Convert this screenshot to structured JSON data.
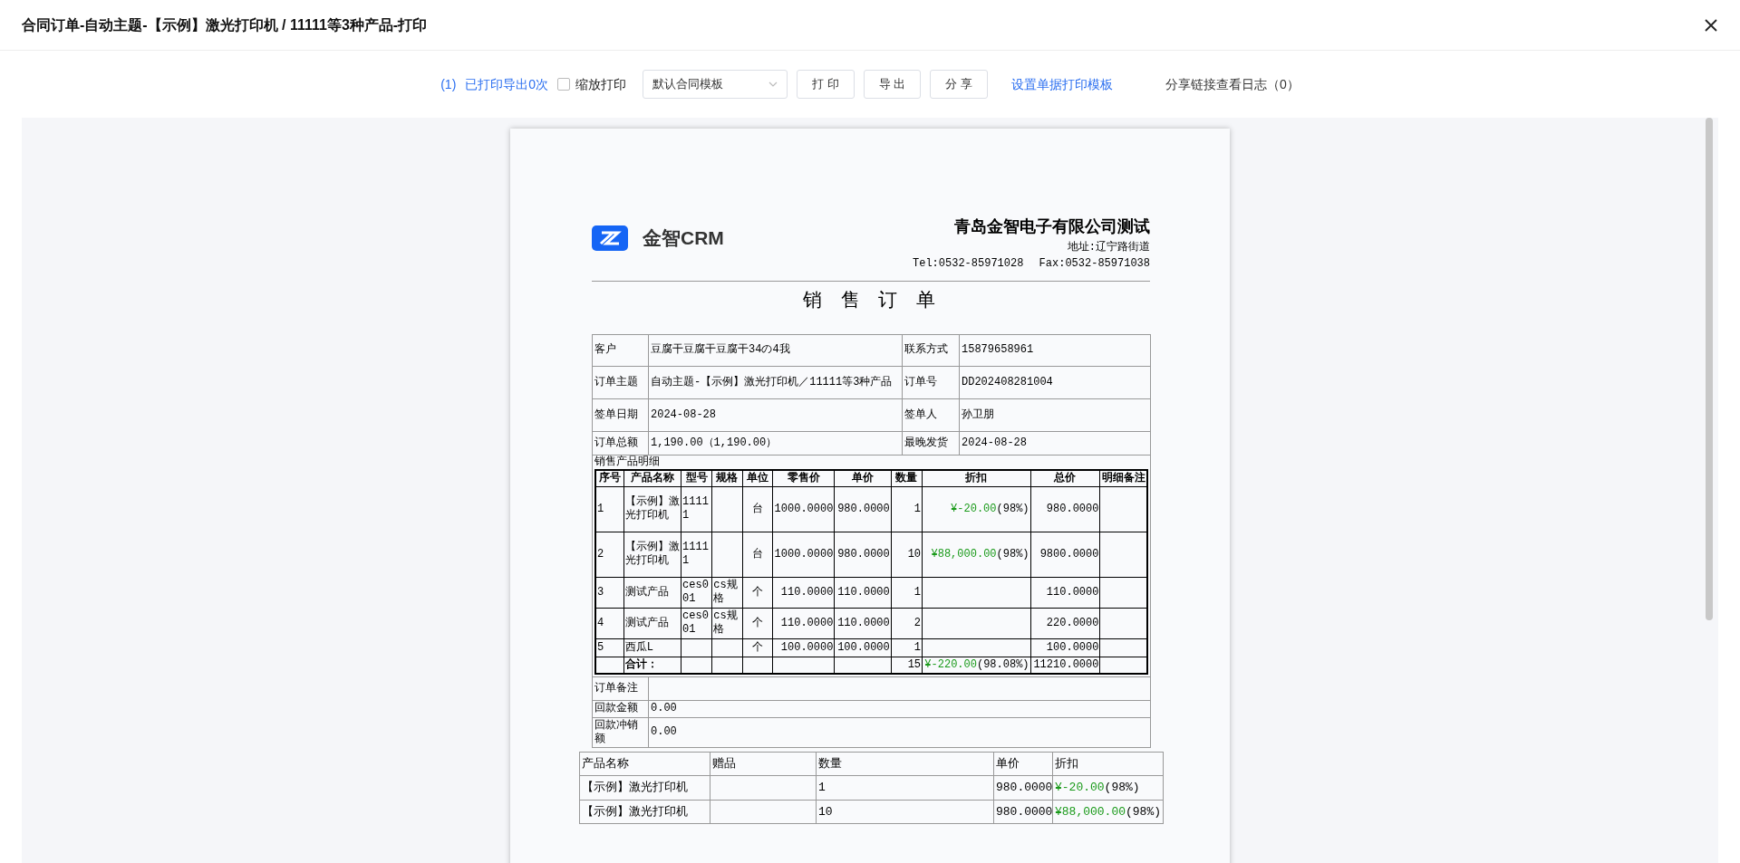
{
  "window": {
    "title": "合同订单-自动主题-【示例】激光打印机 / 11111等3种产品-打印"
  },
  "toolbar": {
    "page_count": "(1)",
    "print_status": "已打印导出0次",
    "scale_print": {
      "label": "缩放打印",
      "checked": false
    },
    "template_select": {
      "value": "默认合同模板"
    },
    "buttons": [
      "打 印",
      "导 出",
      "分 享"
    ],
    "template_link": "设置单据打印模板",
    "share_log": "分享链接查看日志（0）"
  },
  "document": {
    "logo_text": "金智CRM",
    "company": "青岛金智电子有限公司测试",
    "address": "地址:辽宁路街道",
    "tel": "Tel:0532-85971028",
    "fax": "Fax:0532-85971038",
    "title": "销 售 订 单",
    "info_rows": [
      [
        {
          "label": "客户",
          "value": "豆腐干豆腐干豆腐干34の4我"
        },
        {
          "label": "联系方式",
          "value": "  15879658961"
        }
      ],
      [
        {
          "label": "订单主题",
          "value": "自动主题-【示例】激光打印机／11111等3种产品"
        },
        {
          "label": "订单号",
          "value": "DD202408281004"
        }
      ],
      [
        {
          "label": "签单日期",
          "value": "2024-08-28"
        },
        {
          "label": "签单人",
          "value": "孙卫朋"
        }
      ],
      [
        {
          "label": "订单总额",
          "value": "1,190.00（1,190.00）"
        },
        {
          "label": "最晚发货",
          "value": "2024-08-28"
        }
      ]
    ],
    "detail_caption": "销售产品明细",
    "items": {
      "columns": [
        "序号",
        "产品名称",
        "型号",
        "规格",
        "单位",
        "零售价",
        "单价",
        "数量",
        "折扣",
        "总价",
        "明细备注"
      ],
      "rows": [
        {
          "kind": "item",
          "cells": [
            "1",
            "【示例】激光打印机",
            "11111",
            null,
            "台",
            "1000.0000",
            "980.0000",
            "1",
            {
              "amount": "¥-20.00",
              "rate": "(98%)"
            },
            "980.0000",
            null
          ]
        },
        {
          "kind": "item",
          "cells": [
            "2",
            "【示例】激光打印机",
            "11111",
            null,
            "台",
            "1000.0000",
            "980.0000",
            "10",
            {
              "amount": "¥88,000.00",
              "rate": "(98%)"
            },
            "9800.0000",
            null
          ]
        },
        {
          "kind": "item",
          "cells": [
            "3",
            "测试产品",
            "ces001",
            "cs规格",
            "个",
            "110.0000",
            "110.0000",
            "1",
            null,
            "110.0000",
            null
          ]
        },
        {
          "kind": "item",
          "cells": [
            "4",
            "测试产品",
            "ces001",
            "cs规格",
            "个",
            "110.0000",
            "110.0000",
            "2",
            null,
            "220.0000",
            null
          ]
        },
        {
          "kind": "item",
          "cells": [
            "5",
            "西瓜L",
            null,
            null,
            "个",
            "100.0000",
            "100.0000",
            "1",
            null,
            "100.0000",
            null
          ]
        },
        {
          "kind": "total",
          "cells": [
            null,
            "合计：",
            null,
            null,
            null,
            null,
            null,
            "15",
            {
              "amount": "¥-220.00",
              "rate": "(98.08%)"
            },
            "11210.0000",
            null
          ]
        }
      ]
    },
    "remarks": [
      {
        "label": "订单备注"
      },
      {
        "label": "回款金额",
        "value": "0.00"
      },
      {
        "label": "回款冲销额",
        "value": "0.00"
      }
    ],
    "products": {
      "columns": [
        "产品名称",
        "赠品",
        "数量",
        "单价",
        "折扣"
      ],
      "rows": [
        {
          "cells": [
            "【示例】激光打印机",
            null,
            "1",
            "980.0000",
            {
              "amount": "¥-20.00",
              "rate": "(98%)"
            }
          ]
        },
        {
          "cells": [
            "【示例】激光打印机",
            null,
            "10",
            "980.0000",
            {
              "amount": "¥88,000.00",
              "rate": "(98%)"
            }
          ]
        }
      ]
    }
  }
}
